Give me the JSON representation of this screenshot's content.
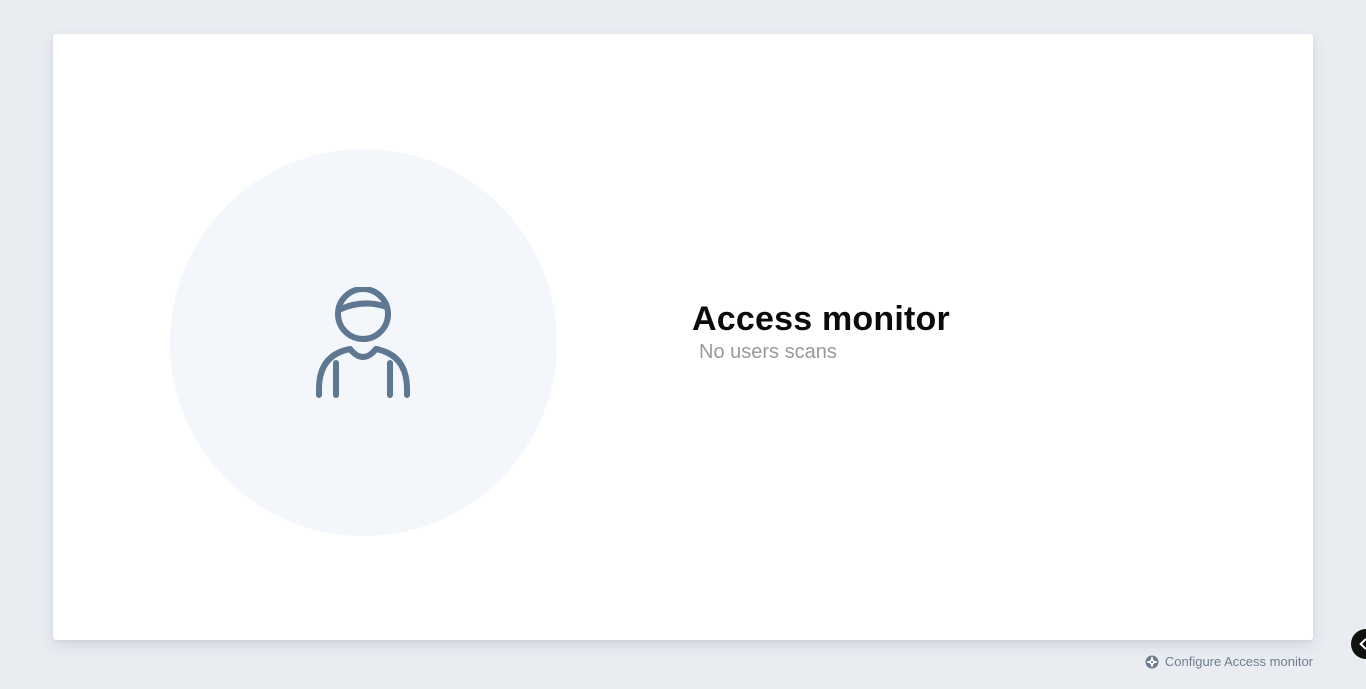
{
  "main": {
    "title": "Access monitor",
    "subtitle": "No users scans",
    "illustration_icon": "user-icon"
  },
  "footer": {
    "configure_label": "Configure Access monitor",
    "configure_icon": "gear-icon"
  },
  "side_toggle": {
    "icon": "chevron-left-icon"
  },
  "colors": {
    "page_background": "#e9edf2",
    "card_background": "#ffffff",
    "avatar_circle": "#f3f7fb",
    "icon_stroke": "#5f7891",
    "title": "#0b0b0b",
    "subtitle": "#9a9a9a",
    "link": "#6e7e90"
  }
}
